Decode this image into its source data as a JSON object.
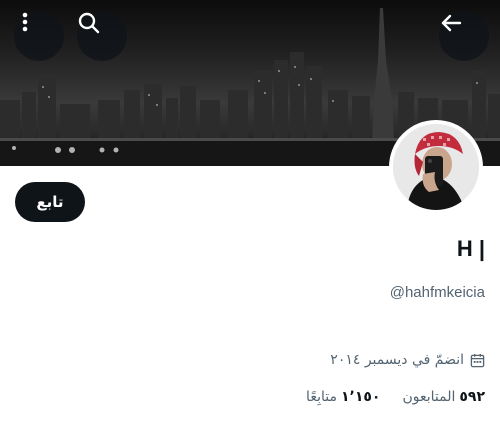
{
  "header": {
    "back_icon": "arrow-left-icon",
    "search_icon": "search-icon",
    "more_icon": "more-vertical-icon"
  },
  "profile": {
    "follow_label": "تابع",
    "name": "H |",
    "handle": "@hahfmkeicia",
    "joined": "انضمّ في ديسمبر ٢٠١٤",
    "following_count": "٥٩٢",
    "following_label": "المتابعون",
    "followers_count": "١٬١٥٠",
    "followers_label": "متابِعًا"
  },
  "colors": {
    "primary_text": "#0f1419",
    "secondary_text": "#536471",
    "button_bg": "#0f1419"
  }
}
